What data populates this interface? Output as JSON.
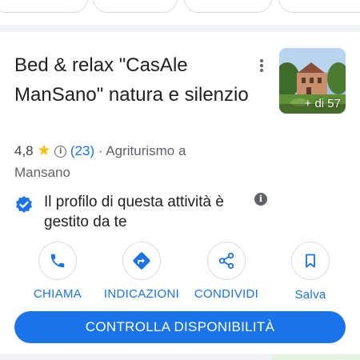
{
  "header": {
    "title": "Bed & relax \"CasAle ManSano\" natura e silenzio"
  },
  "photo": {
    "count_label": "+ di 57"
  },
  "summary": {
    "rating": "4,8",
    "star_glyph": "★",
    "reviews": "(23)",
    "separator": " · ",
    "category": "Agriturismo a",
    "location": "Mansano"
  },
  "ownership": {
    "text": "Il profilo di questa attività è gestito da te",
    "info_glyph": "i"
  },
  "actions": [
    {
      "label": "CHIAMA",
      "icon": "phone-icon"
    },
    {
      "label": "INDICAZIONI",
      "icon": "directions-icon"
    },
    {
      "label": "CONDIVIDI",
      "icon": "share-icon"
    },
    {
      "label": "Salva",
      "icon": "bookmark-icon"
    }
  ],
  "cta": {
    "label": "CONTROLLA DISPONIBILITÀ"
  },
  "colors": {
    "accent": "#1a73e8",
    "star": "#fbbc04",
    "text": "#202124",
    "muted": "#5f6368"
  }
}
